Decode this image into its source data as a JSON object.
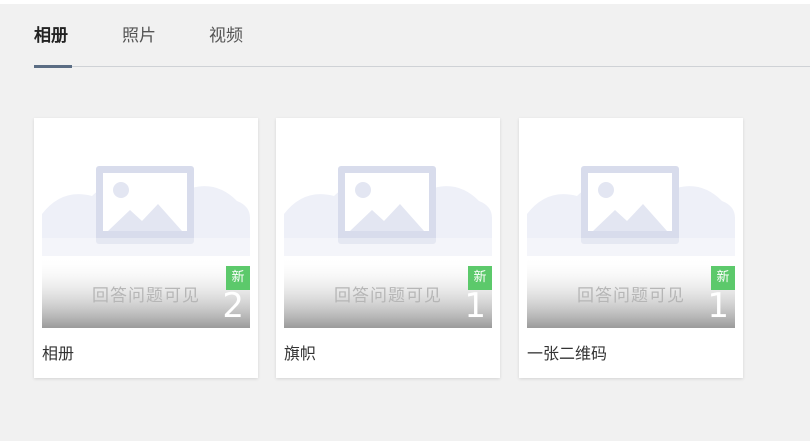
{
  "tabs": [
    {
      "label": "相册",
      "active": true
    },
    {
      "label": "照片",
      "active": false
    },
    {
      "label": "视频",
      "active": false
    }
  ],
  "albums": [
    {
      "title": "相册",
      "count": "2",
      "badge": "新",
      "watermark": "回答问题可见"
    },
    {
      "title": "旗帜",
      "count": "1",
      "badge": "新",
      "watermark": "回答问题可见"
    },
    {
      "title": "一张二维码",
      "count": "1",
      "badge": "新",
      "watermark": "回答问题可见"
    }
  ],
  "colors": {
    "active_tab_underline": "#5b6d84",
    "badge_green": "#5cc96b"
  }
}
